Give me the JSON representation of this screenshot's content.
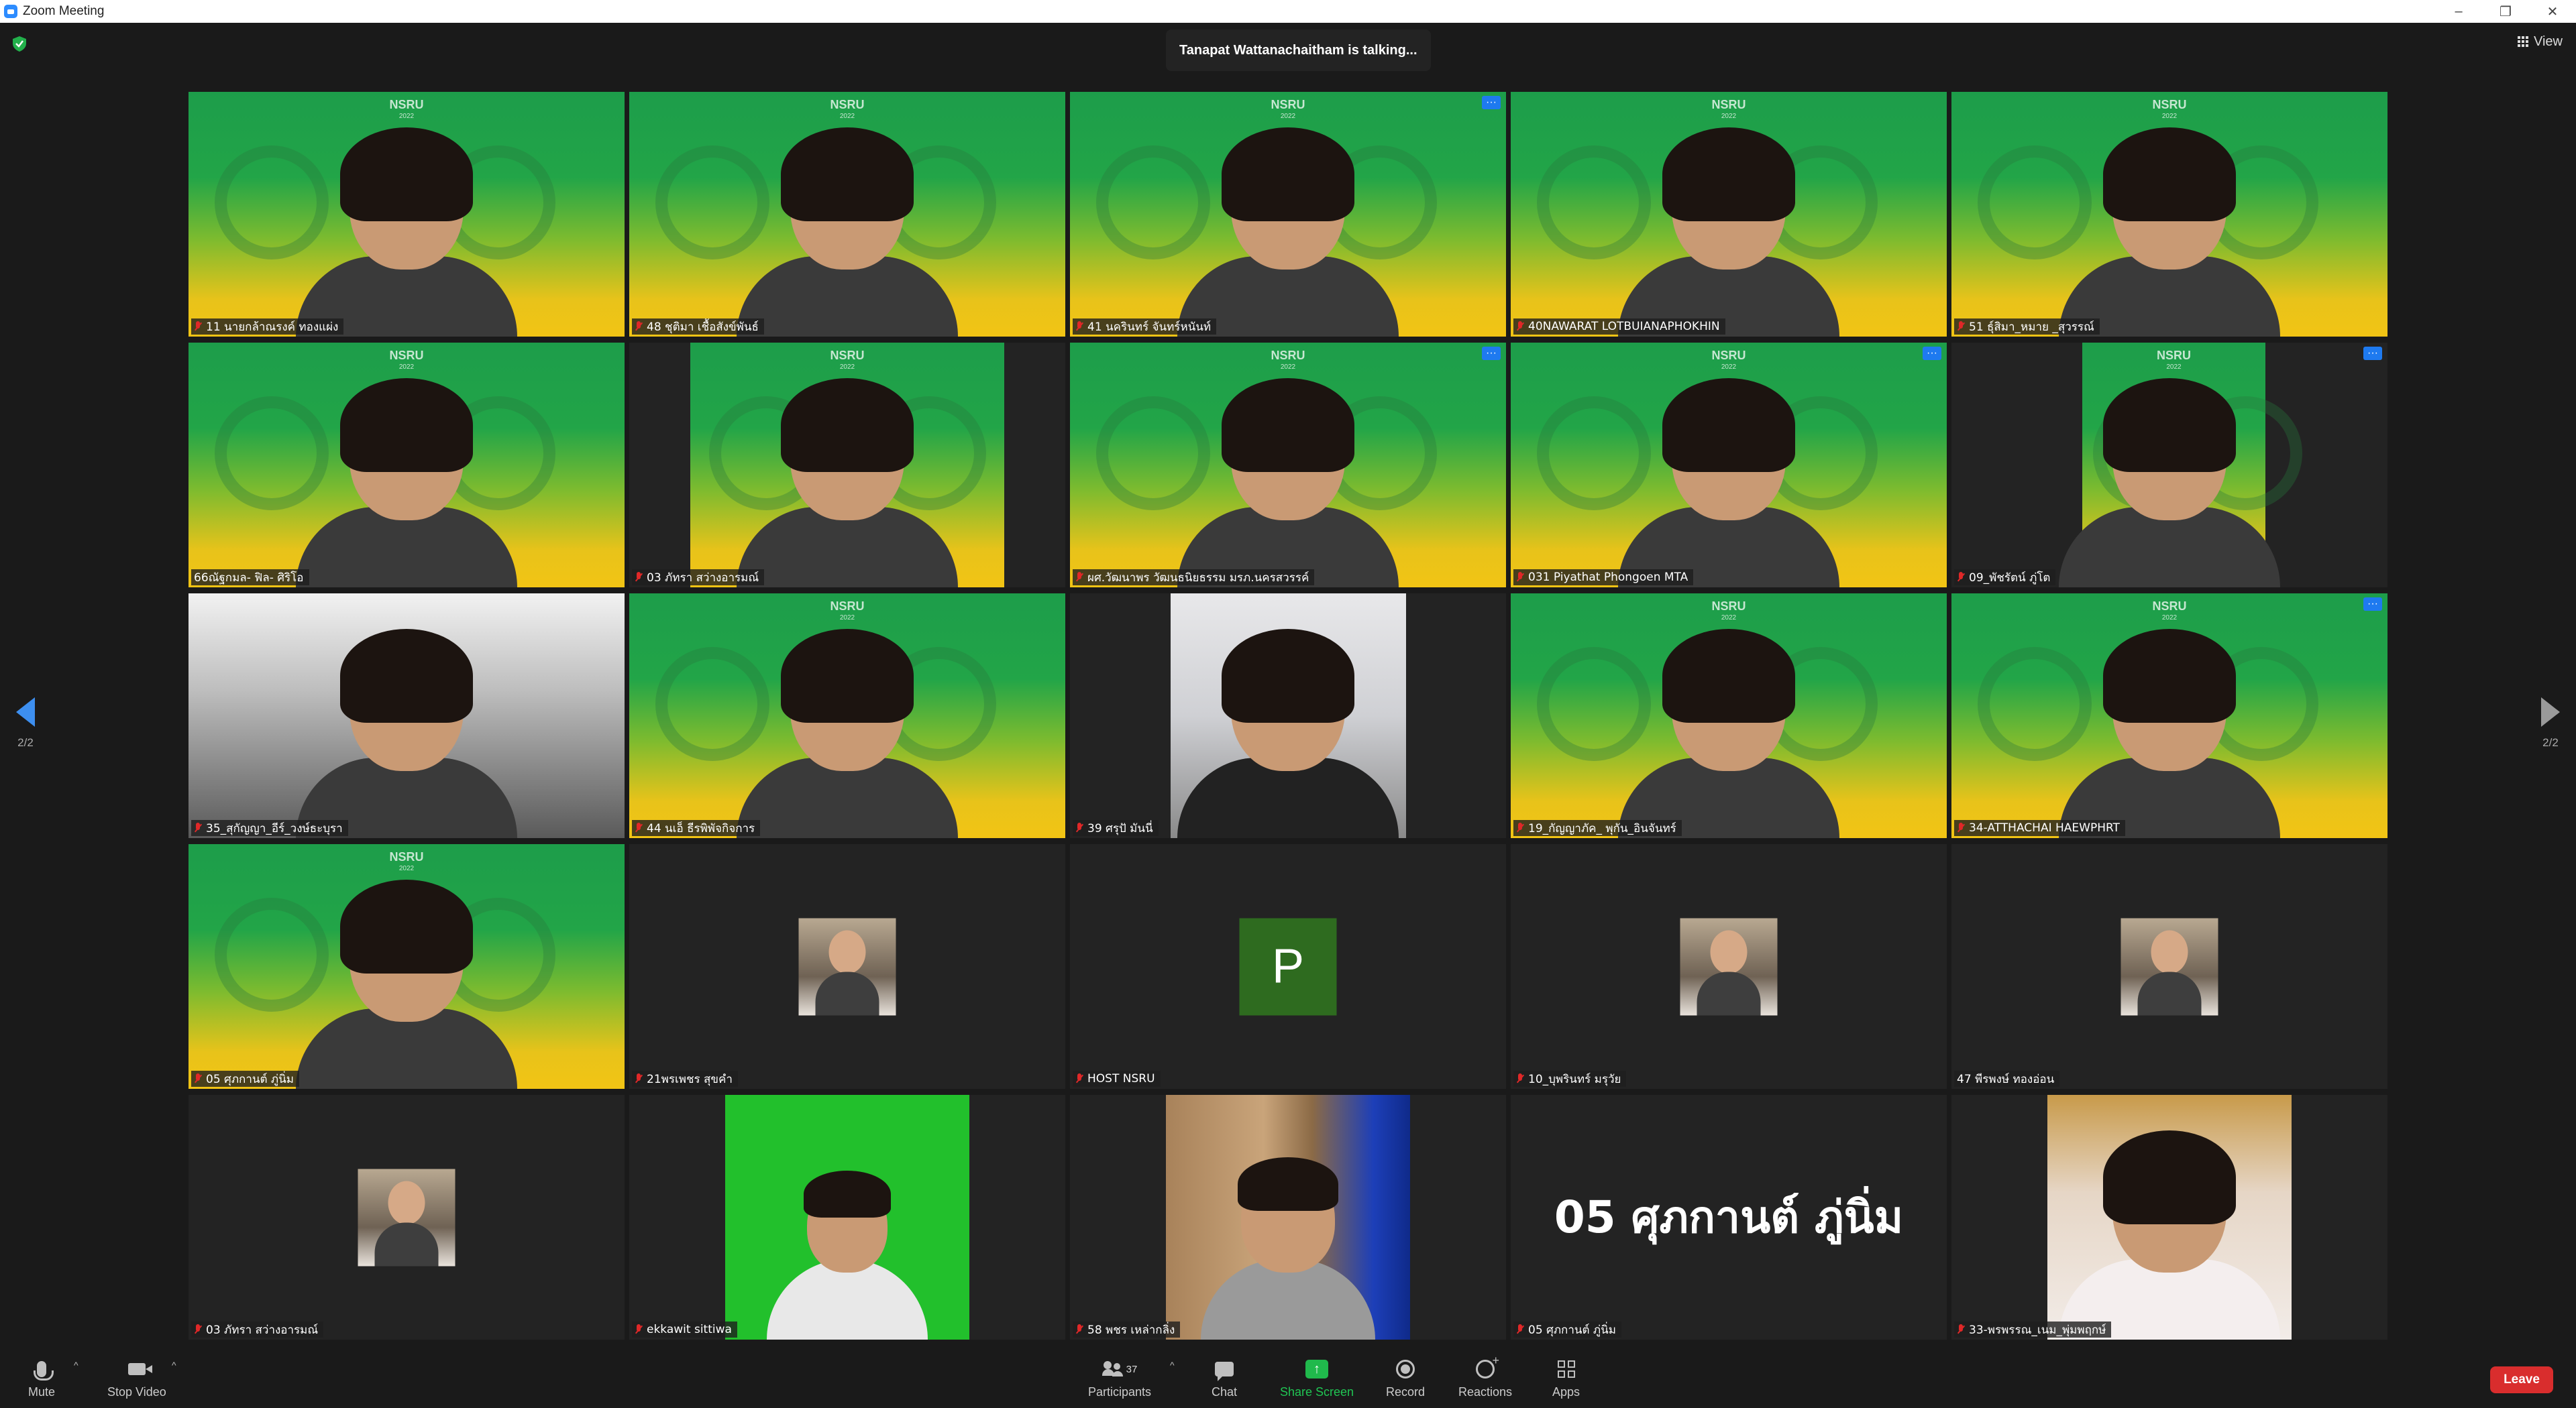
{
  "window": {
    "title": "Zoom Meeting",
    "controls": {
      "minimize": "–",
      "restore": "❐",
      "close": "✕"
    }
  },
  "meeting": {
    "talking_indicator": "Tanapat Wattanachaitham is talking...",
    "view_label": "View",
    "page_indicator": "2/2"
  },
  "participants": [
    {
      "name": "11 นายกล้าณรงค์ ทองแผ่ง",
      "muted": true,
      "bg": "nsru",
      "more": false
    },
    {
      "name": "48 ชุติมา เชื้อสังข์พันธ์",
      "muted": true,
      "bg": "nsru",
      "more": false
    },
    {
      "name": "41 นครินทร์ จันทร์หนันท์",
      "muted": true,
      "bg": "nsru",
      "more": true
    },
    {
      "name": "40NAWARAT LOTBUIANAPHOKHIN",
      "muted": true,
      "bg": "nsru",
      "more": false
    },
    {
      "name": "51 ธุ์สิมา_หมาย _สุวรรณ์",
      "muted": true,
      "bg": "nsru",
      "more": false
    },
    {
      "name": "66ณัฐกมล- ฟิล- ศิริโอ",
      "muted": false,
      "bg": "nsru",
      "more": false
    },
    {
      "name": "03 ภัทรา สว่างอารมณ์",
      "muted": true,
      "bg": "nsru-mid",
      "more": false
    },
    {
      "name": "ผศ.วัฒนาพร วัฒนธนิยธรรม มรภ.นครสวรรค์",
      "muted": true,
      "bg": "nsru",
      "more": true
    },
    {
      "name": "031 Piyathat Phongoen MTA",
      "muted": true,
      "bg": "nsru",
      "more": true
    },
    {
      "name": "09_พัชรัตน์ ภู่โต",
      "muted": true,
      "bg": "nsru-narrow",
      "more": true
    },
    {
      "name": "35_สุกัญญา_อีร์_วงษ์ธะบุรา",
      "muted": true,
      "bg": "car",
      "more": false
    },
    {
      "name": "44 นเอ็ ธีรพิพัจกิจการ",
      "muted": true,
      "bg": "nsru",
      "more": false
    },
    {
      "name": "39 ศรุปั มันนี่",
      "muted": true,
      "bg": "room",
      "more": false
    },
    {
      "name": "19_กัญญาภัค_ พุกัน_อินจันทร์",
      "muted": true,
      "bg": "nsru",
      "more": false
    },
    {
      "name": "34-ATTHACHAI HAEWPHRT",
      "muted": true,
      "bg": "nsru",
      "more": true
    },
    {
      "name": "05 ศุภกานต์ ภู่นิ่ม",
      "muted": true,
      "bg": "nsru",
      "more": false
    },
    {
      "name": "21พรเพชร สุขคำ",
      "muted": true,
      "bg": "avatar",
      "more": false
    },
    {
      "name": "HOST NSRU",
      "muted": true,
      "bg": "letter",
      "letter": "P",
      "more": false
    },
    {
      "name": "10_บุพรินทร์ มรุวัย",
      "muted": true,
      "bg": "avatar",
      "more": false
    },
    {
      "name": "47 พีรพงษ์ ทองอ่อน",
      "muted": false,
      "bg": "avatar",
      "more": false
    },
    {
      "name": "03 ภัทรา สว่างอารมณ์",
      "muted": true,
      "bg": "avatar",
      "more": false
    },
    {
      "name": "ekkawit sittiwa",
      "muted": true,
      "bg": "greenscreen",
      "more": false
    },
    {
      "name": "58 พชร เหล่ากลิ่ง",
      "muted": true,
      "bg": "wood",
      "more": false
    },
    {
      "name": "05 ศุภกานต์ ภู่นิ่ม",
      "muted": true,
      "bg": "bigname",
      "bigname": "05 ศุภกานต์ ภู่นิ่ม",
      "more": false
    },
    {
      "name": "33-พรพรรณ_เนม_พุ่มพฤกษ์",
      "muted": true,
      "bg": "photo",
      "more": false
    }
  ],
  "toolbar": {
    "mute": "Mute",
    "stop_video": "Stop Video",
    "participants": "Participants",
    "participants_count": "37",
    "chat": "Chat",
    "share_screen": "Share Screen",
    "record": "Record",
    "reactions": "Reactions",
    "apps": "Apps",
    "leave": "Leave"
  },
  "colors": {
    "accent": "#2d8cff",
    "share": "#20b94c",
    "leave": "#d92d2d",
    "muted": "#e02828",
    "tile": "#232323",
    "background": "#1a1a1a"
  }
}
